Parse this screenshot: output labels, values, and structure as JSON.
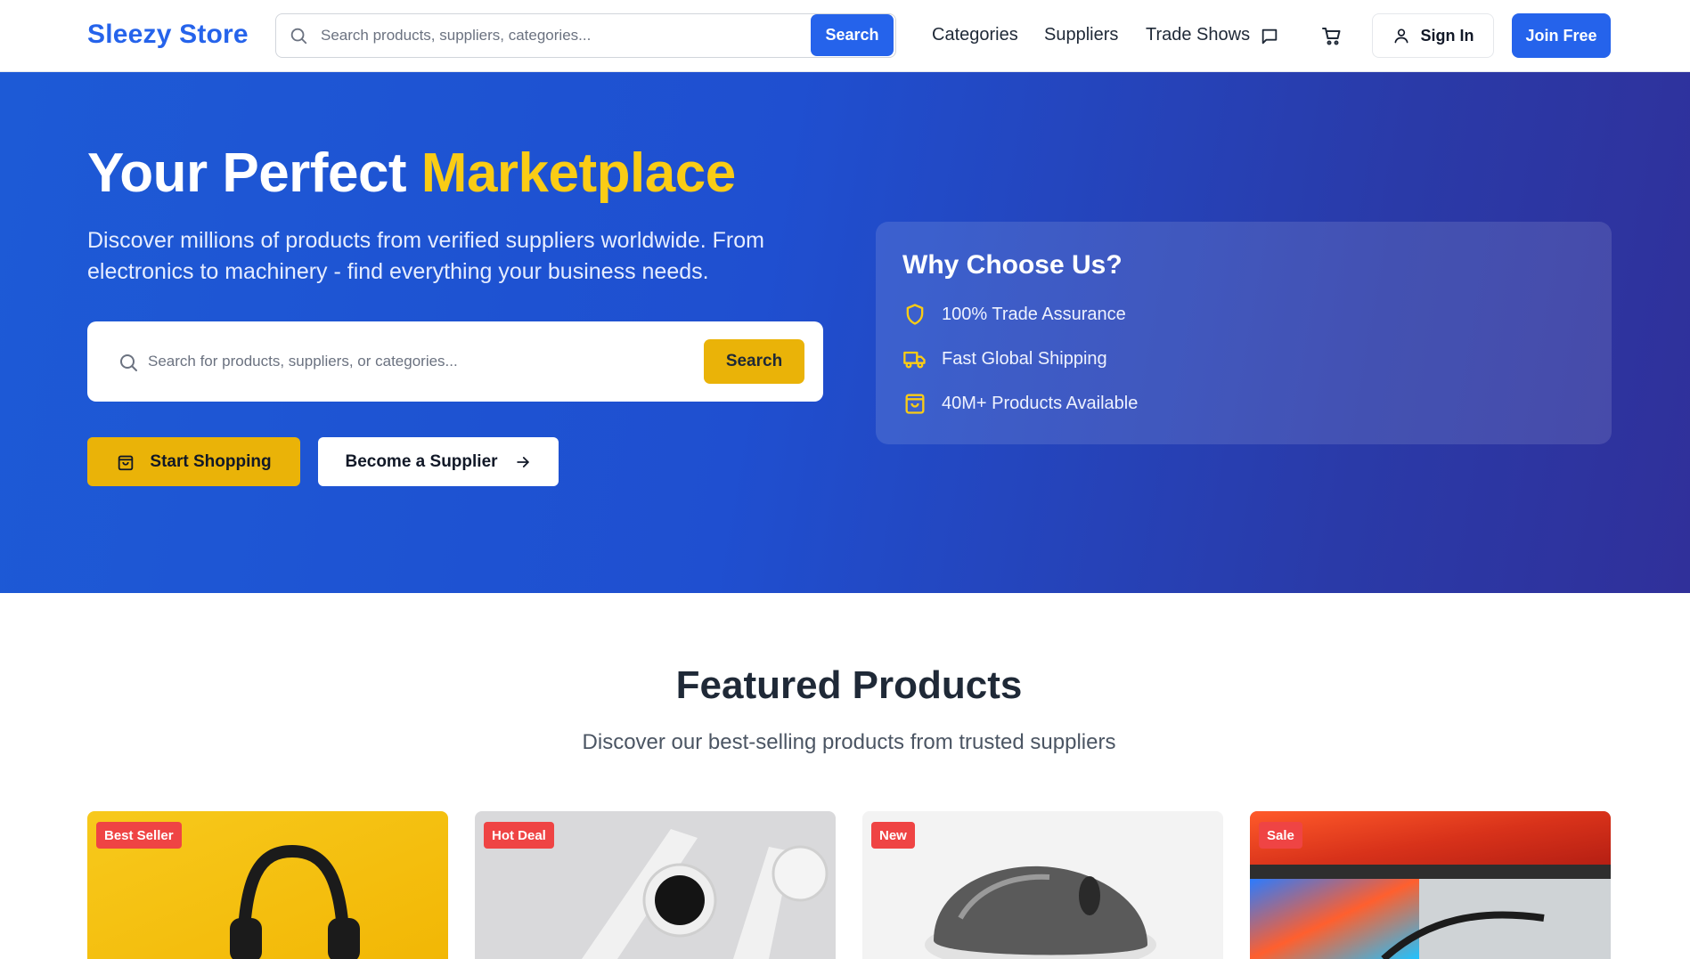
{
  "header": {
    "logo": "Sleezy Store",
    "search_placeholder": "Search products, suppliers, categories...",
    "search_button": "Search",
    "nav": [
      "Categories",
      "Suppliers",
      "Trade Shows"
    ],
    "sign_in": "Sign In",
    "join_free": "Join Free"
  },
  "hero": {
    "title_part1": "Your Perfect ",
    "title_highlight": "Marketplace",
    "description": "Discover millions of products from verified suppliers worldwide. From electronics to machinery - find everything your business needs.",
    "search_placeholder": "Search for products, suppliers, or categories...",
    "search_button": "Search",
    "start_shopping": "Start Shopping",
    "become_supplier": "Become a Supplier",
    "why": {
      "title": "Why Choose Us?",
      "items": [
        "100% Trade Assurance",
        "Fast Global Shipping",
        "40M+ Products Available"
      ]
    }
  },
  "featured": {
    "title": "Featured Products",
    "subtitle": "Discover our best-selling products from trusted suppliers",
    "cards": [
      {
        "badge": "Best Seller",
        "image": "headphones-image"
      },
      {
        "badge": "Hot Deal",
        "image": "smartwatch-image"
      },
      {
        "badge": "New",
        "image": "mouse-image"
      },
      {
        "badge": "Sale",
        "image": "monitor-laptop-image"
      }
    ]
  },
  "colors": {
    "brand": "#2563eb",
    "accent": "#eab308",
    "badge": "#ef4444"
  }
}
